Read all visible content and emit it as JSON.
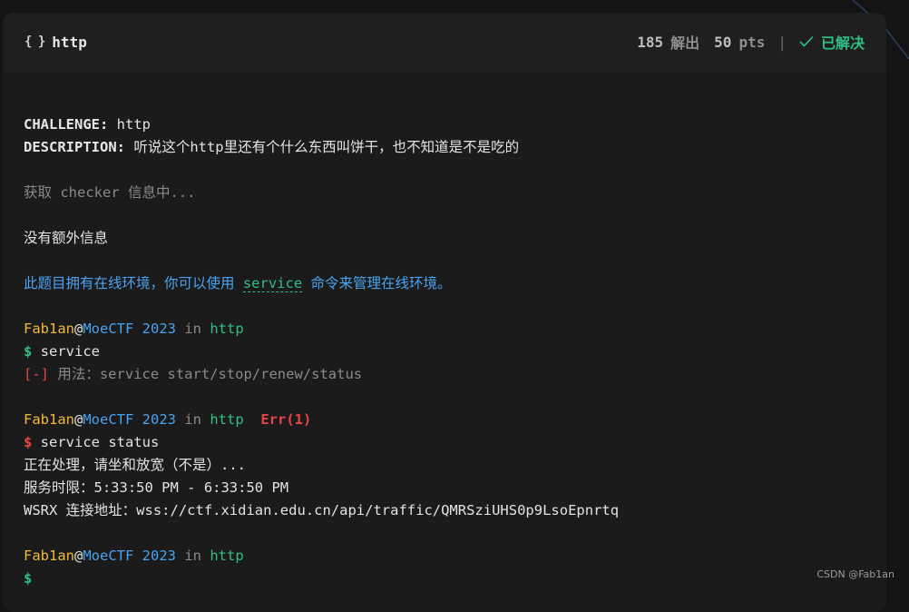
{
  "header": {
    "title": "http",
    "solves_count": "185",
    "solves_label": "解出",
    "points": "50",
    "points_label": "pts",
    "separator": "|",
    "solved_label": "已解决"
  },
  "terminal": {
    "challenge_label": "CHALLENGE:",
    "challenge_value": " http",
    "description_label": "DESCRIPTION:",
    "description_value": " 听说这个http里还有个什么东西叫饼干，也不知道是不是吃的",
    "fetching": "获取 checker 信息中...",
    "no_extra": "没有额外信息",
    "env_pre": "此题目拥有在线环境，你可以使用 ",
    "env_cmd": "service",
    "env_post": " 命令来管理在线环境。",
    "user": "Fab1an",
    "at": "@",
    "host": "MoeCTF 2023",
    "in": " in ",
    "dir": "http",
    "error": "Err(1)",
    "prompt": "$",
    "cmd1": " service",
    "usage_bracket": "[-]",
    "usage_text": " 用法：service start/stop/renew/status",
    "cmd2": " service status",
    "processing": "正在处理，请坐和放宽（不是）...",
    "service_time": "服务时限：5:33:50 PM - 6:33:50 PM",
    "wsrx": "WSRX 连接地址：wss://ctf.xidian.edu.cn/api/traffic/QMRSziUHS0p9LsoEpnrtq"
  },
  "watermark": "CSDN @Fab1an",
  "colors": {
    "background": "#141414",
    "panel": "#1b1b1b",
    "accent_green": "#2fbf83",
    "accent_blue": "#4aa3f0",
    "user_yellow": "#f2b83a",
    "error_red": "#e84545"
  }
}
